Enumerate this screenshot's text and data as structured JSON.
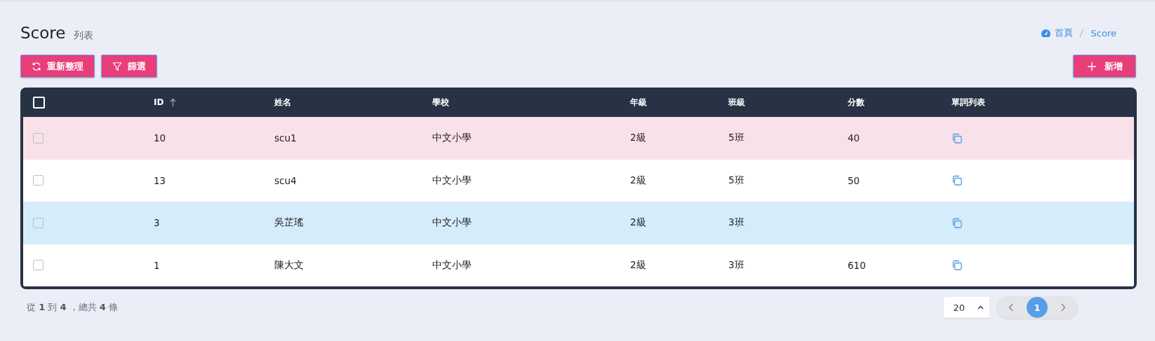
{
  "header": {
    "title": "Score",
    "subtitle": "列表"
  },
  "breadcrumb": [
    {
      "label": "首頁",
      "kind": "home"
    },
    {
      "label": "Score",
      "kind": "page"
    }
  ],
  "toolbar": {
    "buttons": [
      {
        "label": "重新整理",
        "kind": "refresh"
      },
      {
        "label": "篩選",
        "kind": "filter"
      }
    ],
    "add_button": "新增"
  },
  "table": {
    "select_all": {
      "checked": false
    },
    "columns": [
      {
        "label": "ID",
        "sorted": true
      },
      {
        "label": "姓名",
        "sorted": false
      },
      {
        "label": "學校",
        "sorted": false
      },
      {
        "label": "年級",
        "sorted": false
      },
      {
        "label": "班級",
        "sorted": false
      },
      {
        "label": "分數",
        "sorted": false
      },
      {
        "label": "單詞列表",
        "sorted": false
      }
    ],
    "rows": [
      {
        "checked": false,
        "color": "#f8e1e8",
        "cells": [
          "10",
          "scu1",
          "中文小學",
          "2級",
          "5班",
          "40"
        ]
      },
      {
        "checked": false,
        "color": "#ffffff",
        "cells": [
          "13",
          "scu4",
          "中文小學",
          "2級",
          "5班",
          "50"
        ]
      },
      {
        "checked": false,
        "color": "#d5ecfb",
        "cells": [
          "3",
          "吳芷瑤",
          "中文小學",
          "2級",
          "3班",
          null
        ]
      },
      {
        "checked": false,
        "color": "#ffffff",
        "cells": [
          "1",
          "陳大文",
          "中文小學",
          "2級",
          "3班",
          "610"
        ]
      }
    ]
  },
  "footer": {
    "summary": "從 **1** 到 **4** ，總共 **4** 條",
    "page_size": "20",
    "pages": [
      {
        "label": "1",
        "selected": true
      }
    ]
  }
}
